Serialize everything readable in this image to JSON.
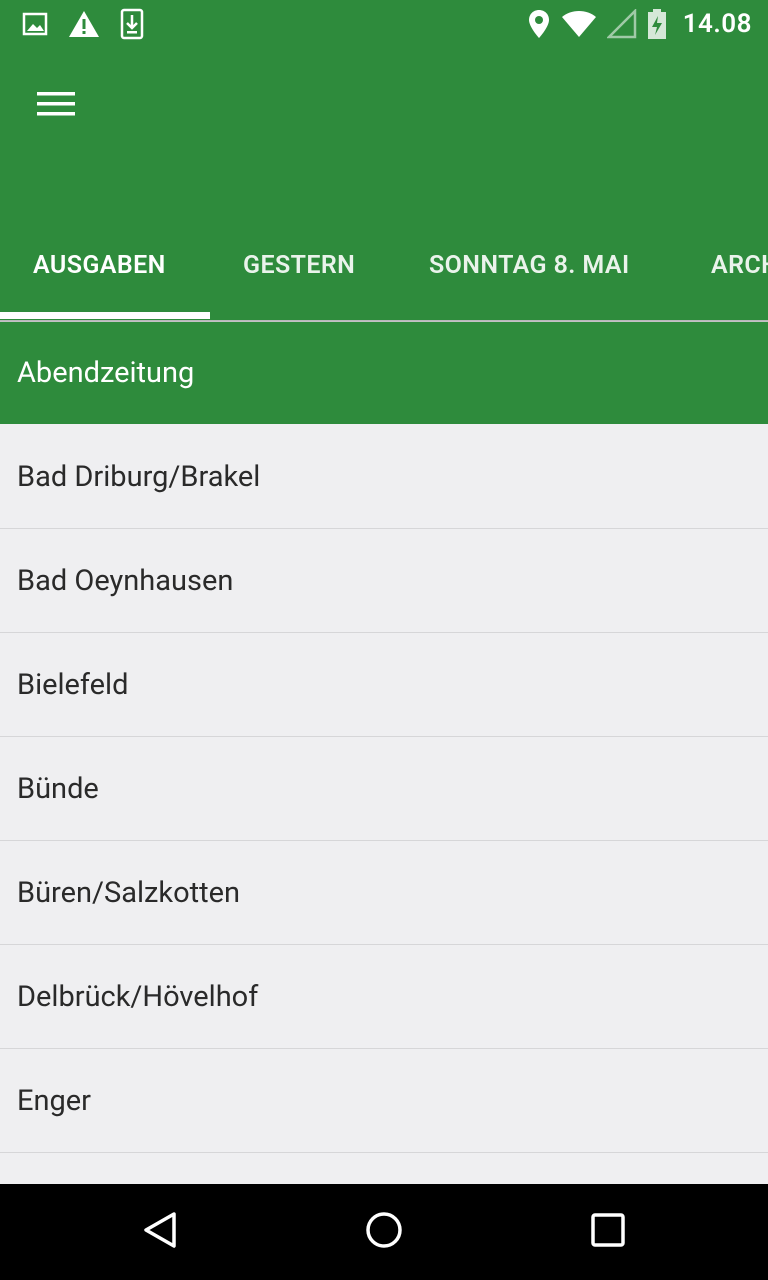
{
  "status_bar": {
    "time": "14.08",
    "left_icons": [
      "image-icon",
      "warning-icon",
      "download-icon"
    ],
    "right_icons": [
      "location-icon",
      "wifi-icon",
      "signal-icon",
      "battery-charging-icon"
    ]
  },
  "toolbar": {
    "menu_icon": "hamburger-menu-icon"
  },
  "tabs": [
    {
      "label": "AUSGABEN",
      "selected": true
    },
    {
      "label": "GESTERN",
      "selected": false
    },
    {
      "label": "SONNTAG 8. MAI",
      "selected": false
    },
    {
      "label": "ARCH",
      "selected": false
    }
  ],
  "section_header": "Abendzeitung",
  "list_items": [
    "Bad Driburg/Brakel",
    "Bad Oeynhausen",
    "Bielefeld",
    "Bünde",
    "Büren/Salzkotten",
    "Delbrück/Hövelhof",
    "Enger"
  ],
  "nav_bar": {
    "icons": [
      "back-icon",
      "home-icon",
      "recents-icon"
    ]
  },
  "colors": {
    "primary": "#2e8b3c",
    "background": "#efeff1",
    "text": "#2a2a2a",
    "nav_bar": "#000000"
  }
}
